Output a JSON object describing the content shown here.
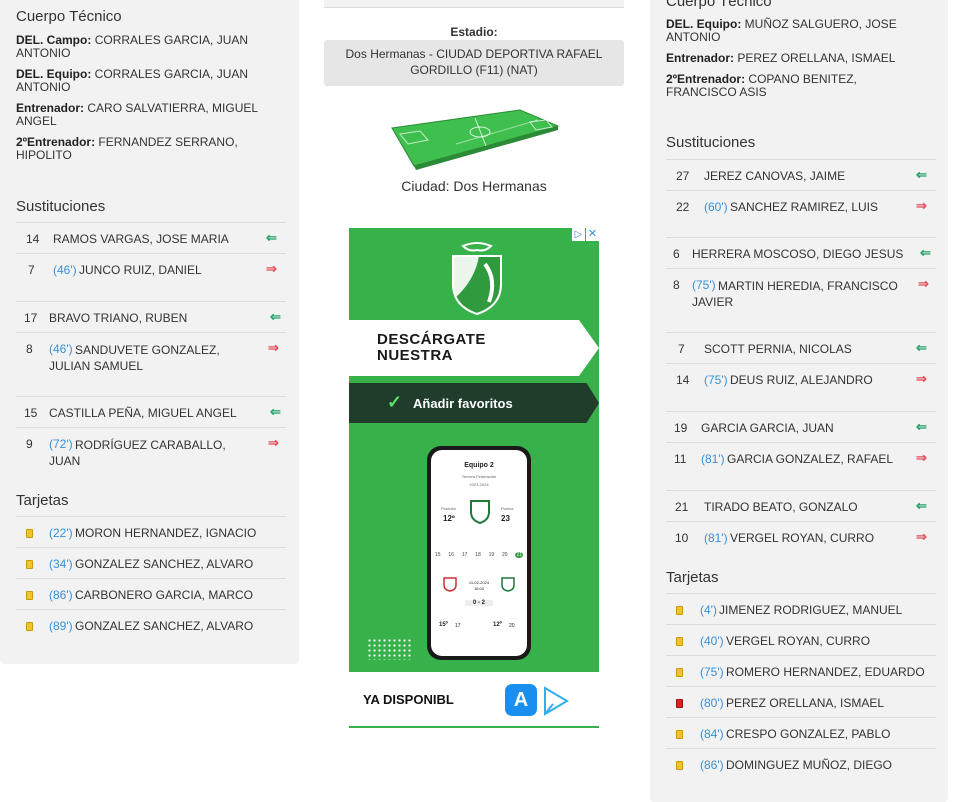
{
  "left": {
    "staff_title": "Cuerpo Técnico",
    "staff": [
      {
        "role": "DEL. Campo:",
        "name": "CORRALES GARCIA, JUAN ANTONIO"
      },
      {
        "role": "DEL. Equipo:",
        "name": "CORRALES GARCIA, JUAN ANTONIO"
      },
      {
        "role": "Entrenador:",
        "name": "CARO SALVATIERRA, MIGUEL ANGEL"
      },
      {
        "role": "2ºEntrenador:",
        "name": "FERNANDEZ SERRANO, HIPOLITO"
      }
    ],
    "subs_title": "Sustituciones",
    "subs": [
      {
        "in_num": "14",
        "in_name": "RAMOS VARGAS, JOSE MARIA",
        "out_num": "7",
        "minute": "(46')",
        "out_name": "JUNCO RUIZ, DANIEL"
      },
      {
        "in_num": "17",
        "in_name": "BRAVO TRIANO, RUBEN",
        "out_num": "8",
        "minute": "(46')",
        "out_name": "SANDUVETE GONZALEZ, JULIAN SAMUEL"
      },
      {
        "in_num": "15",
        "in_name": "CASTILLA PEÑA, MIGUEL ANGEL",
        "out_num": "9",
        "minute": "(72')",
        "out_name": "RODRÍGUEZ CARABALLO, JUAN"
      }
    ],
    "cards_title": "Tarjetas",
    "cards": [
      {
        "minute": "(22')",
        "name": "MORON HERNANDEZ, IGNACIO",
        "color": "yellow"
      },
      {
        "minute": "(34')",
        "name": "GONZALEZ SANCHEZ, ALVARO",
        "color": "yellow"
      },
      {
        "minute": "(86')",
        "name": "CARBONERO GARCIA, MARCO",
        "color": "yellow"
      },
      {
        "minute": "(89')",
        "name": "GONZALEZ SANCHEZ, ALVARO",
        "color": "yellow"
      }
    ]
  },
  "center": {
    "stadium_label": "Estadio:",
    "stadium": "Dos Hermanas - CIUDAD DEPORTIVA RAFAEL GORDILLO (F11) (NAT)",
    "city": "Ciudad: Dos Hermanas",
    "ad": {
      "headline": "DESCÁRGATE NUESTRA",
      "cta": "Añadir favoritos",
      "phone_title": "Equipo 2",
      "phone_subtitle": "Tercera Federación",
      "phone_season": "2023-2024",
      "phone_pos_label": "Posición",
      "phone_pos": "12º",
      "phone_pts_label": "Puntos",
      "phone_pts": "23",
      "phone_days": [
        "15",
        "16",
        "17",
        "18",
        "19",
        "20",
        "21"
      ],
      "phone_date": "11-02-2024",
      "phone_time": "16:00",
      "phone_score": "0 - 2",
      "phone_left_pos": "15º",
      "phone_left_pts": "17",
      "phone_right_pos": "12º",
      "phone_right_pts": "20",
      "footer": "YA DISPONIBL",
      "green": "#37b14a",
      "dark": "#1f3d2a"
    }
  },
  "right": {
    "staff_title": "Cuerpo Técnico",
    "staff": [
      {
        "role": "DEL. Equipo:",
        "name": "MUÑOZ SALGUERO, JOSE ANTONIO"
      },
      {
        "role": "Entrenador:",
        "name": "PEREZ ORELLANA, ISMAEL"
      },
      {
        "role": "2ºEntrenador:",
        "name": "COPANO BENITEZ, FRANCISCO ASIS"
      }
    ],
    "subs_title": "Sustituciones",
    "subs": [
      {
        "in_num": "27",
        "in_name": "JEREZ CANOVAS, JAIME",
        "out_num": "22",
        "minute": "(60')",
        "out_name": "SANCHEZ RAMIREZ, LUIS"
      },
      {
        "in_num": "6",
        "in_name": "HERRERA MOSCOSO, DIEGO JESUS",
        "out_num": "8",
        "minute": "(75')",
        "out_name": "MARTIN HEREDIA, FRANCISCO JAVIER"
      },
      {
        "in_num": "7",
        "in_name": "SCOTT PERNIA, NICOLAS",
        "out_num": "14",
        "minute": "(75')",
        "out_name": "DEUS RUIZ, ALEJANDRO"
      },
      {
        "in_num": "19",
        "in_name": "GARCIA GARCIA, JUAN",
        "out_num": "11",
        "minute": "(81')",
        "out_name": "GARCIA GONZALEZ, RAFAEL"
      },
      {
        "in_num": "21",
        "in_name": "TIRADO BEATO, GONZALO",
        "out_num": "10",
        "minute": "(81')",
        "out_name": "VERGEL ROYAN, CURRO"
      }
    ],
    "cards_title": "Tarjetas",
    "cards": [
      {
        "minute": "(4')",
        "name": "JIMENEZ RODRIGUEZ, MANUEL",
        "color": "yellow"
      },
      {
        "minute": "(40')",
        "name": "VERGEL ROYAN, CURRO",
        "color": "yellow"
      },
      {
        "minute": "(75')",
        "name": "ROMERO HERNANDEZ, EDUARDO",
        "color": "yellow"
      },
      {
        "minute": "(80')",
        "name": "PEREZ ORELLANA, ISMAEL",
        "color": "red"
      },
      {
        "minute": "(84')",
        "name": "CRESPO GONZALEZ, PABLO",
        "color": "yellow"
      },
      {
        "minute": "(86')",
        "name": "DOMINGUEZ MUÑOZ, DIEGO",
        "color": "yellow"
      }
    ]
  }
}
